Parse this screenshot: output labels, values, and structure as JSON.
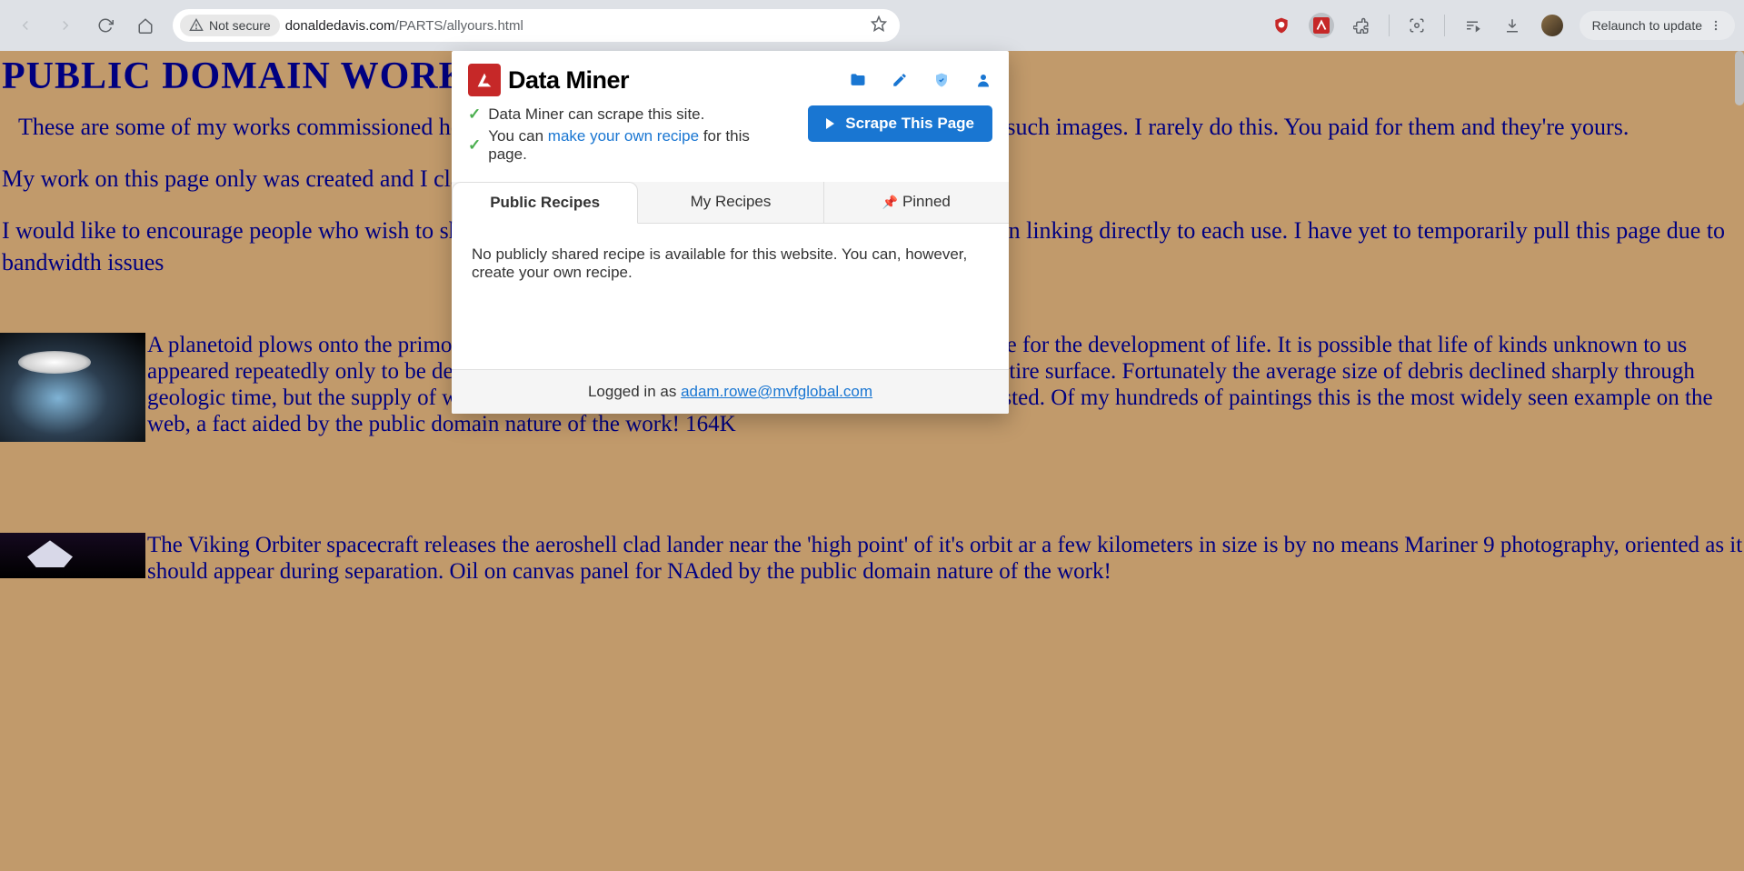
{
  "browser": {
    "not_secure": "Not secure",
    "url_domain": "donaldedavis.com",
    "url_path": "/PARTS/allyours.html",
    "relaunch": "Relaunch to update"
  },
  "page": {
    "title": "PUBLIC DOMAIN WORKS D",
    "para1": "These are some of my works commissioned here to provide something like definitive digital versions of such images. I rarely do this. You paid for them and they're yours.",
    "para2": "My work on this page only was created and I claim copyright on the artwork and text.",
    "para3": "I would like to encourage people who wish to share these onto other sites for further distribution rather than linking directly to each use. I have yet to temporarily pull this page due to bandwidth issues",
    "item1_desc": "A planetoid plows onto the primordial Earth, during the eons of time when conditions were ripe for the development of life. It is possible that life of kinds unknown to us appeared repeatedly only to be destroyed in collisions like this one which could 'rework' the entire surface. Fortunately the average size of debris declined sharply through geologic time, but the supply of wayward rocks a few kilometers in size is by no means exhausted. Of my hundreds of paintings this is the most widely seen example on the web, a fact aided by the public domain nature of the work! 164K",
    "item2_desc": "The Viking Orbiter spacecraft releases the aeroshell clad lander near the 'high point' of it's orbit ar a few kilometers in size is by no means Mariner 9 photography, oriented as it should appear during separation. Oil on canvas panel for NAded by the public domain nature of the work!"
  },
  "popup": {
    "brand": "Data Miner",
    "status1": "Data Miner can scrape this site.",
    "status2_pre": "You can ",
    "status2_link": "make your own recipe",
    "status2_post": " for this page.",
    "scrape_btn": "Scrape This Page",
    "tabs": {
      "public": "Public Recipes",
      "my": "My Recipes",
      "pinned": "Pinned"
    },
    "body": "No publicly shared recipe is available for this website. You can, however, create your own recipe.",
    "footer_pre": "Logged in as ",
    "footer_email": "adam.rowe@mvfglobal.com"
  }
}
